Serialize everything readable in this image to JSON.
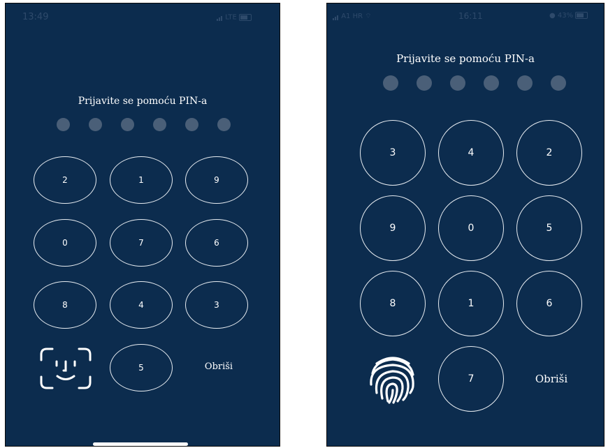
{
  "screens": [
    {
      "status": {
        "time": "13:49",
        "network": "LTE"
      },
      "title": "Prijavite se pomoću PIN-a",
      "pin_dots": 6,
      "keys": [
        "2",
        "1",
        "9",
        "0",
        "7",
        "6",
        "8",
        "4",
        "3",
        "5"
      ],
      "biometric_icon": "face-id-icon",
      "delete_label": "Obriši"
    },
    {
      "status": {
        "carrier": "A1 HR",
        "time": "16:11",
        "battery": "43%"
      },
      "title": "Prijavite se pomoću PIN-a",
      "pin_dots": 6,
      "keys": [
        "3",
        "4",
        "2",
        "9",
        "0",
        "5",
        "8",
        "1",
        "6",
        "7"
      ],
      "biometric_icon": "fingerprint-icon",
      "delete_label": "Obriši"
    }
  ],
  "colors": {
    "background": "#0c2c4e",
    "dot": "#4a5f78",
    "outline": "#e8edf2"
  }
}
